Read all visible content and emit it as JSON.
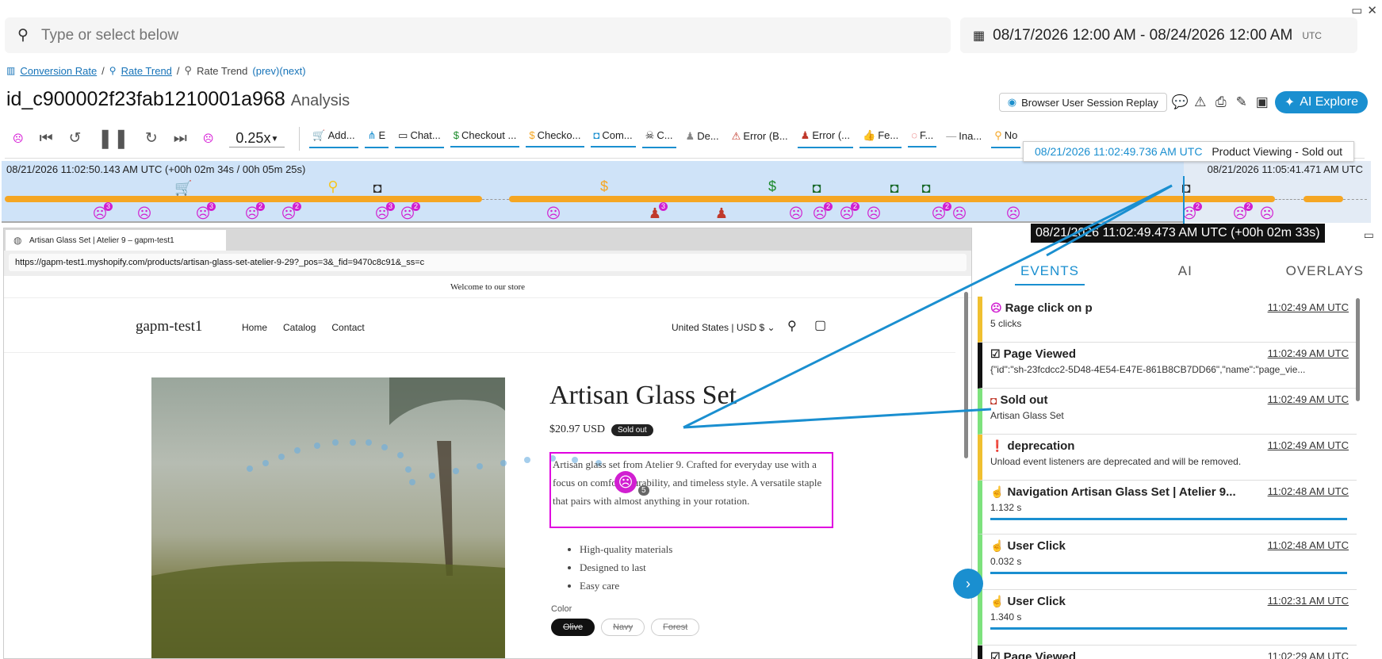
{
  "window": {
    "maximize_icon": "maximize-icon",
    "close_icon": "close-icon"
  },
  "search": {
    "placeholder": "Type or select below"
  },
  "date_range": {
    "value": "08/17/2026 12:00 AM - 08/24/2026 12:00 AM",
    "tz": "UTC"
  },
  "breadcrumb": {
    "item1": "Conversion Rate",
    "sep": "/",
    "item2": "Rate Trend",
    "item3": "Rate Trend",
    "prev": "(prev)",
    "next": "(next)"
  },
  "page": {
    "title": "id_c900002f23fab1210001a968",
    "subtitle": "Analysis"
  },
  "title_actions": {
    "session_replay": "Browser User Session Replay",
    "ai_explore": "AI Explore"
  },
  "player": {
    "speed": "0.25x"
  },
  "event_chips": [
    "Add...",
    "E",
    "Chat...",
    "Checkout ...",
    "Checko...",
    "Com...",
    "C...",
    "De...",
    "Error (B...",
    "Error (...",
    "Fe...",
    "F...",
    "Ina...",
    "No"
  ],
  "timeline": {
    "start": "08/21/2026 11:02:50.143 AM UTC (+00h 02m 34s / 00h 05m 25s)",
    "end": "08/21/2026 11:05:41.471 AM UTC",
    "tooltip_time": "08/21/2026 11:02:49.736 AM UTC",
    "tooltip_label": "Product Viewing - Sold out",
    "hover_time": "08/21/2026 11:02:49.473 AM UTC (+00h 02m 33s)",
    "badges": [
      "3",
      "3",
      "2",
      "2",
      "3",
      "2",
      "3",
      "2",
      "2",
      "2",
      "2",
      "2"
    ]
  },
  "browser": {
    "tab_title": "Artisan Glass Set | Atelier 9 – gapm-test1",
    "url": "https://gapm-test1.myshopify.com/products/artisan-glass-set-atelier-9-29?_pos=3&_fid=9470c8c91&_ss=c"
  },
  "site": {
    "announcement": "Welcome to our store",
    "shop_name": "gapm-test1",
    "nav": [
      "Home",
      "Catalog",
      "Contact"
    ],
    "region": "United States | USD $",
    "product_title": "Artisan Glass Set",
    "price": "$20.97 USD",
    "sold_out": "Sold out",
    "description": "Artisan glass set from Atelier 9. Crafted for everyday use with a focus on comfort, durability, and timeless style. A versatile staple that pairs with almost anything in your rotation.",
    "bullets": [
      "High-quality materials",
      "Designed to last",
      "Easy care"
    ],
    "color_label": "Color",
    "colors": [
      "Olive",
      "Navy",
      "Forest"
    ],
    "rage_count": "5"
  },
  "panel": {
    "tabs": [
      "EVENTS",
      "AI",
      "OVERLAYS"
    ],
    "events": [
      {
        "title": "Rage click on p",
        "time": "11:02:49 AM UTC",
        "sub": "5 clicks",
        "icon": "rage-click-icon"
      },
      {
        "title": "Page Viewed",
        "time": "11:02:49 AM UTC",
        "sub": "{\"id\":\"sh-23fcdcc2-5D48-4E54-E47E-861B8CB7DD66\",\"name\":\"page_vie...",
        "icon": "checkbox-icon"
      },
      {
        "title": "Sold out",
        "time": "11:02:49 AM UTC",
        "sub": "Artisan Glass Set",
        "icon": "sold-out-icon"
      },
      {
        "title": "deprecation",
        "time": "11:02:49 AM UTC",
        "sub": "Unload event listeners are deprecated and will be removed.",
        "icon": "alert-icon"
      },
      {
        "title": "Navigation Artisan Glass Set | Atelier 9...",
        "time": "11:02:48 AM UTC",
        "sub": "1.132 s",
        "icon": "pointer-icon"
      },
      {
        "title": "User Click",
        "time": "11:02:48 AM UTC",
        "sub": "0.032 s",
        "icon": "pointer-icon"
      },
      {
        "title": "User Click",
        "time": "11:02:31 AM UTC",
        "sub": "1.340 s",
        "icon": "pointer-icon"
      },
      {
        "title": "Page Viewed",
        "time": "11:02:29 AM UTC",
        "sub": "",
        "icon": "checkbox-icon"
      }
    ]
  },
  "colors": {
    "accent": "#1a8fd0",
    "rage": "#d11fd1",
    "timeline_bg": "#cfe3f8",
    "bar": "#f5a623"
  }
}
